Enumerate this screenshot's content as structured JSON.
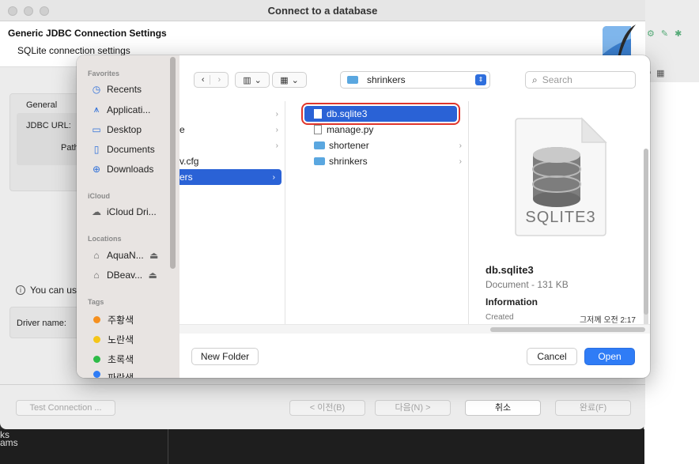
{
  "dialog": {
    "title": "Connect to a database",
    "header_title": "Generic JDBC Connection Settings",
    "header_subtitle": "SQLite connection settings",
    "general_label": "General",
    "jdbc_url_label": "JDBC URL:",
    "path_label": "Path:",
    "info_text": "You can us",
    "driver_name_label": "Driver name:",
    "test_connection": "Test Connection ...",
    "back": "< 이전(B)",
    "next": "다음(N) >",
    "cancel": "취소",
    "finish": "완료(F)"
  },
  "background": {
    "bottom_left_1": "ks",
    "bottom_left_2": "ams"
  },
  "picker": {
    "sidebar": {
      "favorites_label": "Favorites",
      "favorites": [
        {
          "label": "Recents",
          "icon": "clock-icon"
        },
        {
          "label": "Applicati...",
          "icon": "applications-icon"
        },
        {
          "label": "Desktop",
          "icon": "desktop-icon"
        },
        {
          "label": "Documents",
          "icon": "document-icon"
        },
        {
          "label": "Downloads",
          "icon": "download-icon"
        }
      ],
      "icloud_label": "iCloud",
      "icloud_item": "iCloud Dri...",
      "locations_label": "Locations",
      "locations": [
        "AquaN...",
        "DBeav..."
      ],
      "tags_label": "Tags",
      "tags": [
        {
          "label": "주황색",
          "color": "#f5901e"
        },
        {
          "label": "노란색",
          "color": "#f5c518"
        },
        {
          "label": "초록색",
          "color": "#2dbb47"
        },
        {
          "label": "파란색",
          "color": "#2f7cf6"
        }
      ]
    },
    "toolbar": {
      "current_folder": "shrinkers",
      "search_placeholder": "Search"
    },
    "column1": [
      "e",
      "v.cfg",
      "ers"
    ],
    "column2": [
      {
        "name": "db.sqlite3",
        "kind": "file",
        "selected": true
      },
      {
        "name": "manage.py",
        "kind": "file"
      },
      {
        "name": "shortener",
        "kind": "folder"
      },
      {
        "name": "shrinkers",
        "kind": "folder"
      }
    ],
    "preview": {
      "badge": "SQLITE3",
      "name": "db.sqlite3",
      "kind": "Document - 131 KB",
      "info_heading": "Information",
      "created_label": "Created",
      "created_value": "그저께 오전 2:17"
    },
    "new_folder": "New Folder",
    "cancel": "Cancel",
    "open": "Open"
  },
  "colors": {
    "accent": "#2f7cf6",
    "selection": "#2a62d6",
    "highlight_border": "#e0352b"
  }
}
